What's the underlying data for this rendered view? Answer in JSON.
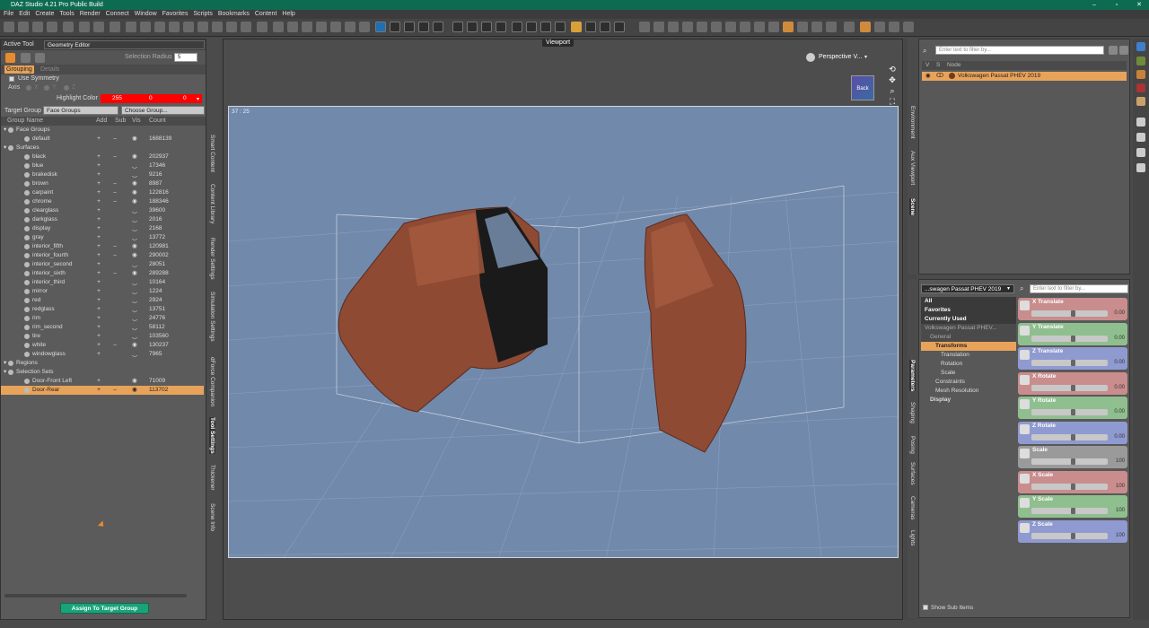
{
  "app": {
    "title": "DAZ Studio 4.21 Pro Public Build",
    "window_controls": [
      "–",
      "▫",
      "✕"
    ]
  },
  "menu": [
    "File",
    "Edit",
    "Create",
    "Tools",
    "Render",
    "Connect",
    "Window",
    "Favorites",
    "Scripts",
    "Bookmarks",
    "Content",
    "Help"
  ],
  "left_panel": {
    "active_tool_label": "Active Tool",
    "active_tool_value": "Geometry Editor",
    "selection_radius_label": "Selection Radius",
    "selection_radius_value": "5",
    "tabs": [
      "Grouping",
      "Details"
    ],
    "use_symmetry": "Use Symmetry",
    "axis_label": "Axis",
    "axis_options": [
      "X",
      "Y",
      "Z"
    ],
    "highlight_color_label": "Highlight Color",
    "highlight_rgb": [
      "255",
      "0",
      "0"
    ],
    "target_group_label": "Target Group",
    "target_group_value": "Face Groups",
    "choose_group": "Choose Group...",
    "columns": [
      "Group Name",
      "Add",
      "Sub",
      "Vis",
      "Count"
    ],
    "rows": [
      {
        "name": "Face Groups",
        "level": 0,
        "count": "",
        "add": "",
        "sub": "",
        "vis": "",
        "section": true
      },
      {
        "name": "default",
        "level": 1,
        "count": "1688139",
        "add": "+",
        "sub": "–",
        "vis": "◉"
      },
      {
        "name": "Surfaces",
        "level": 0,
        "count": "",
        "add": "",
        "sub": "",
        "vis": "",
        "section": true
      },
      {
        "name": "black",
        "level": 1,
        "count": "202937",
        "add": "+",
        "sub": "–",
        "vis": "◉"
      },
      {
        "name": "blue",
        "level": 1,
        "count": "17346",
        "add": "+",
        "sub": "",
        "vis": "‿"
      },
      {
        "name": "brakedisk",
        "level": 1,
        "count": "9216",
        "add": "+",
        "sub": "",
        "vis": "‿"
      },
      {
        "name": "brown",
        "level": 1,
        "count": "8987",
        "add": "+",
        "sub": "–",
        "vis": "◉"
      },
      {
        "name": "carpaint",
        "level": 1,
        "count": "122816",
        "add": "+",
        "sub": "–",
        "vis": "◉"
      },
      {
        "name": "chrome",
        "level": 1,
        "count": "188346",
        "add": "+",
        "sub": "–",
        "vis": "◉"
      },
      {
        "name": "clearglass",
        "level": 1,
        "count": "39600",
        "add": "+",
        "sub": "",
        "vis": "‿"
      },
      {
        "name": "darkglass",
        "level": 1,
        "count": "2016",
        "add": "+",
        "sub": "",
        "vis": "‿"
      },
      {
        "name": "display",
        "level": 1,
        "count": "2168",
        "add": "+",
        "sub": "",
        "vis": "‿"
      },
      {
        "name": "gray",
        "level": 1,
        "count": "13772",
        "add": "+",
        "sub": "",
        "vis": "‿"
      },
      {
        "name": "interior_fifth",
        "level": 1,
        "count": "120981",
        "add": "+",
        "sub": "–",
        "vis": "◉"
      },
      {
        "name": "interior_fourth",
        "level": 1,
        "count": "290002",
        "add": "+",
        "sub": "–",
        "vis": "◉"
      },
      {
        "name": "interior_second",
        "level": 1,
        "count": "28051",
        "add": "+",
        "sub": "",
        "vis": "‿"
      },
      {
        "name": "interior_sixth",
        "level": 1,
        "count": "289288",
        "add": "+",
        "sub": "–",
        "vis": "◉"
      },
      {
        "name": "interior_third",
        "level": 1,
        "count": "10164",
        "add": "+",
        "sub": "",
        "vis": "‿"
      },
      {
        "name": "mirror",
        "level": 1,
        "count": "1224",
        "add": "+",
        "sub": "",
        "vis": "‿"
      },
      {
        "name": "red",
        "level": 1,
        "count": "2924",
        "add": "+",
        "sub": "",
        "vis": "‿"
      },
      {
        "name": "redglass",
        "level": 1,
        "count": "13751",
        "add": "+",
        "sub": "",
        "vis": "‿"
      },
      {
        "name": "rim",
        "level": 1,
        "count": "24776",
        "add": "+",
        "sub": "",
        "vis": "‿"
      },
      {
        "name": "rim_second",
        "level": 1,
        "count": "58112",
        "add": "+",
        "sub": "",
        "vis": "‿"
      },
      {
        "name": "tire",
        "level": 1,
        "count": "103560",
        "add": "+",
        "sub": "",
        "vis": "‿"
      },
      {
        "name": "white",
        "level": 1,
        "count": "130237",
        "add": "+",
        "sub": "–",
        "vis": "◉"
      },
      {
        "name": "windowglass",
        "level": 1,
        "count": "7965",
        "add": "+",
        "sub": "",
        "vis": "‿"
      },
      {
        "name": "Regions",
        "level": 0,
        "count": "",
        "add": "",
        "sub": "",
        "vis": "",
        "section": true
      },
      {
        "name": "Selection Sets",
        "level": 0,
        "count": "",
        "add": "",
        "sub": "",
        "vis": "",
        "section": true
      },
      {
        "name": "Door-Front Left",
        "level": 1,
        "count": "71009",
        "add": "+",
        "sub": "",
        "vis": "◉"
      },
      {
        "name": "Door-Rear",
        "level": 1,
        "count": "113702",
        "add": "+",
        "sub": "–",
        "vis": "◉",
        "selected": true
      }
    ],
    "assign_button": "Assign To Target Group"
  },
  "left_vertical_tabs": [
    "Smart Content",
    "Content Library",
    "Render Settings",
    "Simulation Settings",
    "dForce Companion",
    "Tool Settings",
    "Thickener",
    "Scene Info"
  ],
  "viewport": {
    "tab": "Viewport",
    "camera": "Perspective V...",
    "aspect": "37 : 25",
    "cube_label": "Back"
  },
  "scene_panel": {
    "filter_placeholder": "Enter text to filter by...",
    "columns": [
      "V",
      "S",
      "Node"
    ],
    "node": "Volkswagen Passat PHEV 2019"
  },
  "scene_vertical_tabs": [
    "Environment",
    "Aux Viewport",
    "Scene"
  ],
  "params_panel": {
    "node_select": "...swagen Passat PHEV 2019",
    "filter_placeholder": "Enter text to filter by...",
    "tree": [
      {
        "label": "All",
        "level": 0,
        "bold": true
      },
      {
        "label": "Favorites",
        "level": 0,
        "bold": true
      },
      {
        "label": "Currently Used",
        "level": 0,
        "bold": true
      },
      {
        "label": "Volkswagen Passat PHEV...",
        "level": 0,
        "bold": false,
        "header": true
      },
      {
        "label": "General",
        "level": 1,
        "bold": false,
        "header": true
      },
      {
        "label": "Transforms",
        "level": 2,
        "bold": true,
        "selected": true
      },
      {
        "label": "Translation",
        "level": 3,
        "bold": false
      },
      {
        "label": "Rotation",
        "level": 3,
        "bold": false
      },
      {
        "label": "Scale",
        "level": 3,
        "bold": false
      },
      {
        "label": "Constraints",
        "level": 2,
        "bold": false
      },
      {
        "label": "Mesh Resolution",
        "level": 2,
        "bold": false
      },
      {
        "label": "Display",
        "level": 1,
        "bold": true
      }
    ],
    "show_sub_items": "Show Sub Items",
    "sliders": [
      {
        "label": "X Translate",
        "value": "0.00",
        "color": "#c98d8d"
      },
      {
        "label": "Y Translate",
        "value": "0.00",
        "color": "#8fbf8f"
      },
      {
        "label": "Z Translate",
        "value": "0.00",
        "color": "#8f9ad0"
      },
      {
        "label": "X Rotate",
        "value": "0.00",
        "color": "#c98d8d"
      },
      {
        "label": "Y Rotate",
        "value": "0.00",
        "color": "#8fbf8f"
      },
      {
        "label": "Z Rotate",
        "value": "0.00",
        "color": "#8f9ad0"
      },
      {
        "label": "Scale",
        "value": "100",
        "color": "#9a9a9a"
      },
      {
        "label": "X Scale",
        "value": "100",
        "color": "#c98d8d"
      },
      {
        "label": "Y Scale",
        "value": "100",
        "color": "#8fbf8f"
      },
      {
        "label": "Z Scale",
        "value": "100",
        "color": "#8f9ad0"
      }
    ]
  },
  "params_vertical_tabs": [
    "Parameters",
    "Shaping",
    "Posing",
    "Surfaces",
    "Cameras",
    "Lights"
  ]
}
